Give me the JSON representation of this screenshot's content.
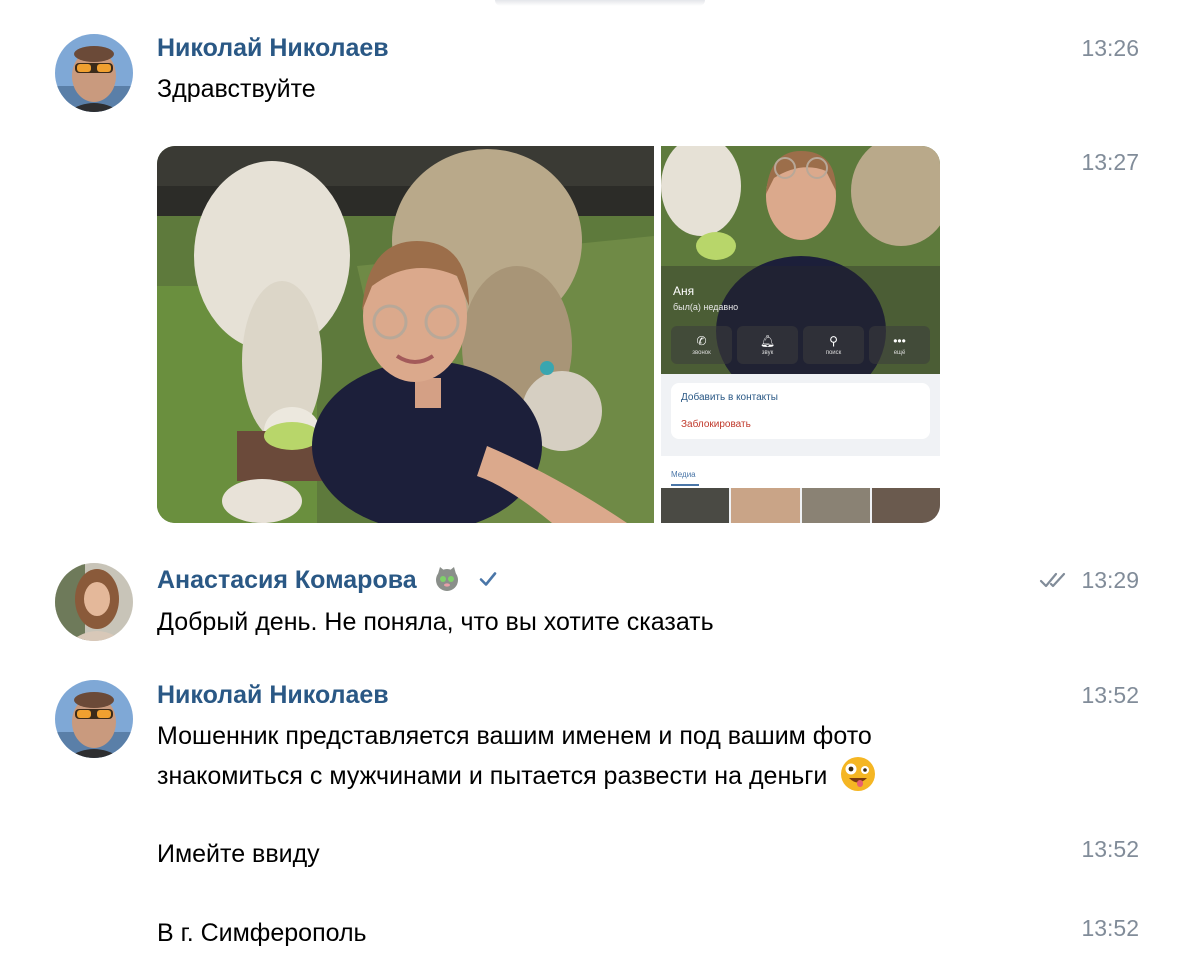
{
  "messages": [
    {
      "author": "Николай Николаев",
      "text": "Здравствуйте",
      "time": "13:26"
    },
    {
      "time": "13:27"
    },
    {
      "author": "Анастасия Комарова",
      "text": "Добрый день. Не поняла, что вы хотите сказать",
      "time": "13:29"
    },
    {
      "author": "Николай Николаев",
      "text_line1": "Мошенник представляется вашим именем и под вашим фото",
      "text_line2": "знакомиться с мужчинами и пытается развести на деньги",
      "time": "13:52"
    },
    {
      "text": "Имейте ввиду",
      "time": "13:52"
    },
    {
      "text": "В г. Симферополь",
      "time": "13:52"
    }
  ],
  "screenshot": {
    "profile_name": "Аня",
    "profile_status": "был(а) недавно",
    "actions": [
      {
        "icon": "phone-icon",
        "label": "звонок"
      },
      {
        "icon": "bell-icon",
        "label": "звук"
      },
      {
        "icon": "search-icon",
        "label": "поиск"
      },
      {
        "icon": "more-icon",
        "label": "ещё"
      }
    ],
    "add_contact": "Добавить в контакты",
    "block": "Заблокировать",
    "media_tab": "Медиа"
  },
  "colors": {
    "author_name": "#2a5885",
    "time": "#818c99",
    "verified": "#4a76a8"
  }
}
